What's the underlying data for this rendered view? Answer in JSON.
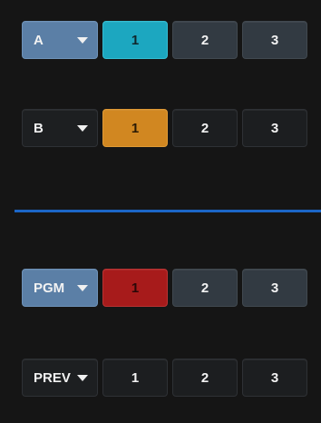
{
  "colors": {
    "background": "#151515",
    "divider": "#1c66c6",
    "cyan_active": "#1ca7c0",
    "orange_active": "#d18721",
    "red_active": "#a71b1b",
    "blue_selector": "#5b7fa6"
  },
  "rows": {
    "a": {
      "selector": "A",
      "buttons": [
        "1",
        "2",
        "3"
      ],
      "active": "1"
    },
    "b": {
      "selector": "B",
      "buttons": [
        "1",
        "2",
        "3"
      ],
      "active": "1"
    },
    "pgm": {
      "selector": "PGM",
      "buttons": [
        "1",
        "2",
        "3"
      ],
      "active": "1"
    },
    "prev": {
      "selector": "PREV",
      "buttons": [
        "1",
        "2",
        "3"
      ],
      "active": null
    }
  }
}
